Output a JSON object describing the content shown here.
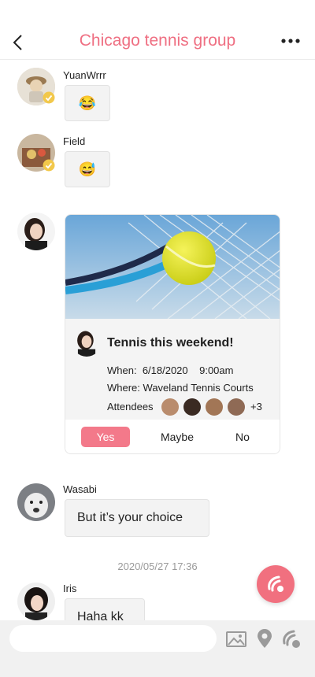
{
  "header": {
    "title": "Chicago tennis group",
    "back_icon": "chevron-left-icon",
    "more_icon": "more-dots-icon"
  },
  "messages": [
    {
      "sender": "YuanWrrr",
      "content": "😂",
      "type": "emoji",
      "verified": true
    },
    {
      "sender": "Field",
      "content": "😅",
      "type": "emoji",
      "verified": true
    },
    {
      "sender": "",
      "type": "event-card"
    },
    {
      "sender": "Wasabi",
      "content": "But it’s your choice",
      "type": "text"
    },
    {
      "sender": "Iris",
      "content": "Haha kk",
      "type": "text"
    }
  ],
  "event": {
    "title": "Tennis this weekend!",
    "when_label": "When:",
    "date": "6/18/2020",
    "time": "9:00am",
    "where_label": "Where:",
    "location": "Waveland Tennis Courts",
    "attendees_label": "Attendees",
    "extra_attendees": "+3",
    "rsvp": {
      "yes": "Yes",
      "maybe": "Maybe",
      "no": "No",
      "selected": "yes"
    }
  },
  "timestamp": "2020/05/27 17:36",
  "composer": {
    "placeholder": ""
  },
  "colors": {
    "accent": "#ef6f82",
    "fab": "#f1707f",
    "bubble": "#f3f3f3",
    "bar": "#f1f1f1"
  }
}
